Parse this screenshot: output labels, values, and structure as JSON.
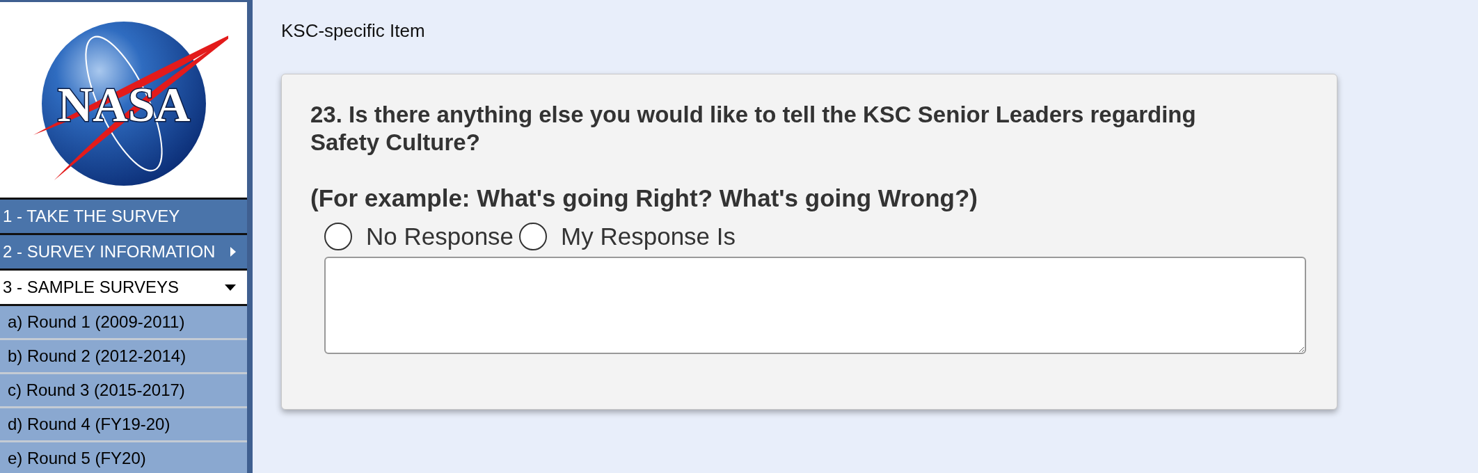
{
  "logo": {
    "text": "NASA"
  },
  "sidebar": {
    "items": [
      {
        "label": "1 - TAKE THE SURVEY",
        "selected": false
      },
      {
        "label": "2 - SURVEY INFORMATION",
        "selected": false,
        "expanded": false
      },
      {
        "label": "3 - SAMPLE SURVEYS",
        "selected": true,
        "expanded": true,
        "children": [
          {
            "label": "a) Round 1 (2009-2011)"
          },
          {
            "label": "b) Round 2 (2012-2014)"
          },
          {
            "label": "c) Round 3 (2015-2017)"
          },
          {
            "label": "d) Round 4 (FY19-20)"
          },
          {
            "label": "e) Round 5 (FY20)"
          }
        ]
      }
    ]
  },
  "page_title": "KSC-specific Item",
  "question": {
    "text": "23. Is there anything else you would like to tell the KSC Senior Leaders regarding Safety Culture?",
    "example": "(For example: What's going Right? What's going Wrong?)",
    "options": [
      {
        "label": "No Response",
        "selected": false
      },
      {
        "label": "My Response Is",
        "selected": false
      }
    ]
  }
}
